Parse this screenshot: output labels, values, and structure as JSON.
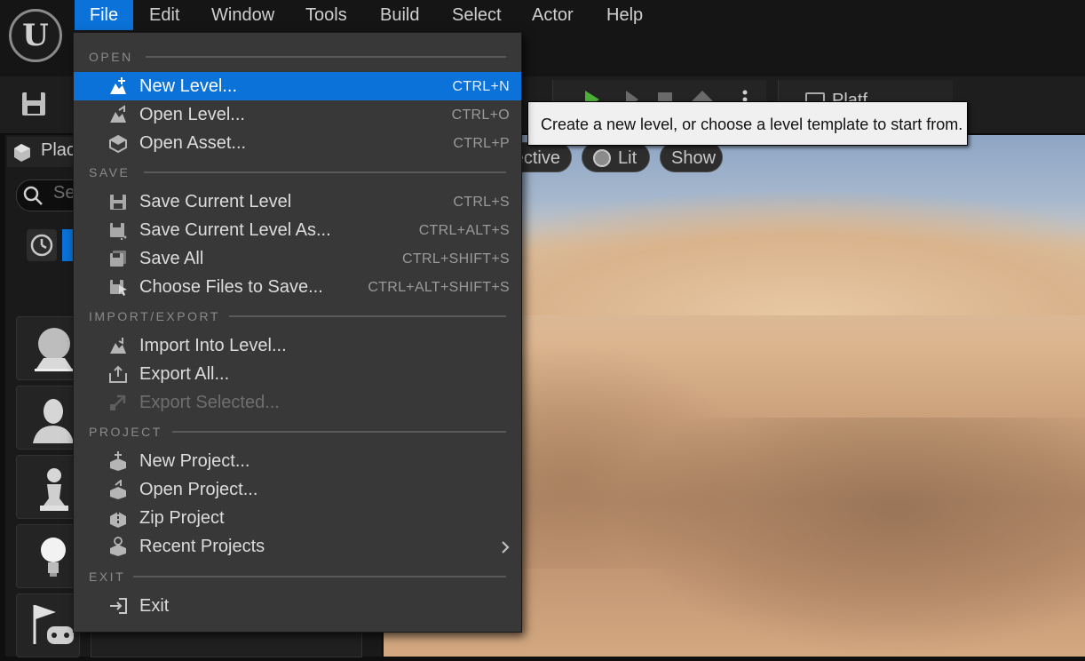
{
  "menubar": {
    "items": [
      "File",
      "Edit",
      "Window",
      "Tools",
      "Build",
      "Select",
      "Actor",
      "Help"
    ],
    "active": "File"
  },
  "left_panel": {
    "title": "Plac",
    "search_placeholder": "Se"
  },
  "viewport": {
    "perspective_label": "ective",
    "lit_label": "Lit",
    "show_label": "Show",
    "platforms_label": "Platf"
  },
  "tooltip": {
    "text": "Create a new level, or choose a level template to start from."
  },
  "file_menu": {
    "sections": {
      "open": "OPEN",
      "save": "SAVE",
      "import_export": "IMPORT/EXPORT",
      "project": "PROJECT",
      "exit": "EXIT"
    },
    "items": {
      "new_level": {
        "label": "New Level...",
        "shortcut": "CTRL+N"
      },
      "open_level": {
        "label": "Open Level...",
        "shortcut": "CTRL+O"
      },
      "open_asset": {
        "label": "Open Asset...",
        "shortcut": "CTRL+P"
      },
      "save_current_level": {
        "label": "Save Current Level",
        "shortcut": "CTRL+S"
      },
      "save_current_level_as": {
        "label": "Save Current Level As...",
        "shortcut": "CTRL+ALT+S"
      },
      "save_all": {
        "label": "Save All",
        "shortcut": "CTRL+SHIFT+S"
      },
      "choose_files_to_save": {
        "label": "Choose Files to Save...",
        "shortcut": "CTRL+ALT+SHIFT+S"
      },
      "import_into_level": {
        "label": "Import Into Level..."
      },
      "export_all": {
        "label": "Export All..."
      },
      "export_selected": {
        "label": "Export Selected...",
        "disabled": true
      },
      "new_project": {
        "label": "New Project..."
      },
      "open_project": {
        "label": "Open Project..."
      },
      "zip_project": {
        "label": "Zip Project"
      },
      "recent_projects": {
        "label": "Recent Projects"
      },
      "exit": {
        "label": "Exit"
      }
    }
  },
  "colors": {
    "accent": "#0a72d8",
    "menu_bg": "#383838",
    "menubar_bg": "#151515"
  }
}
